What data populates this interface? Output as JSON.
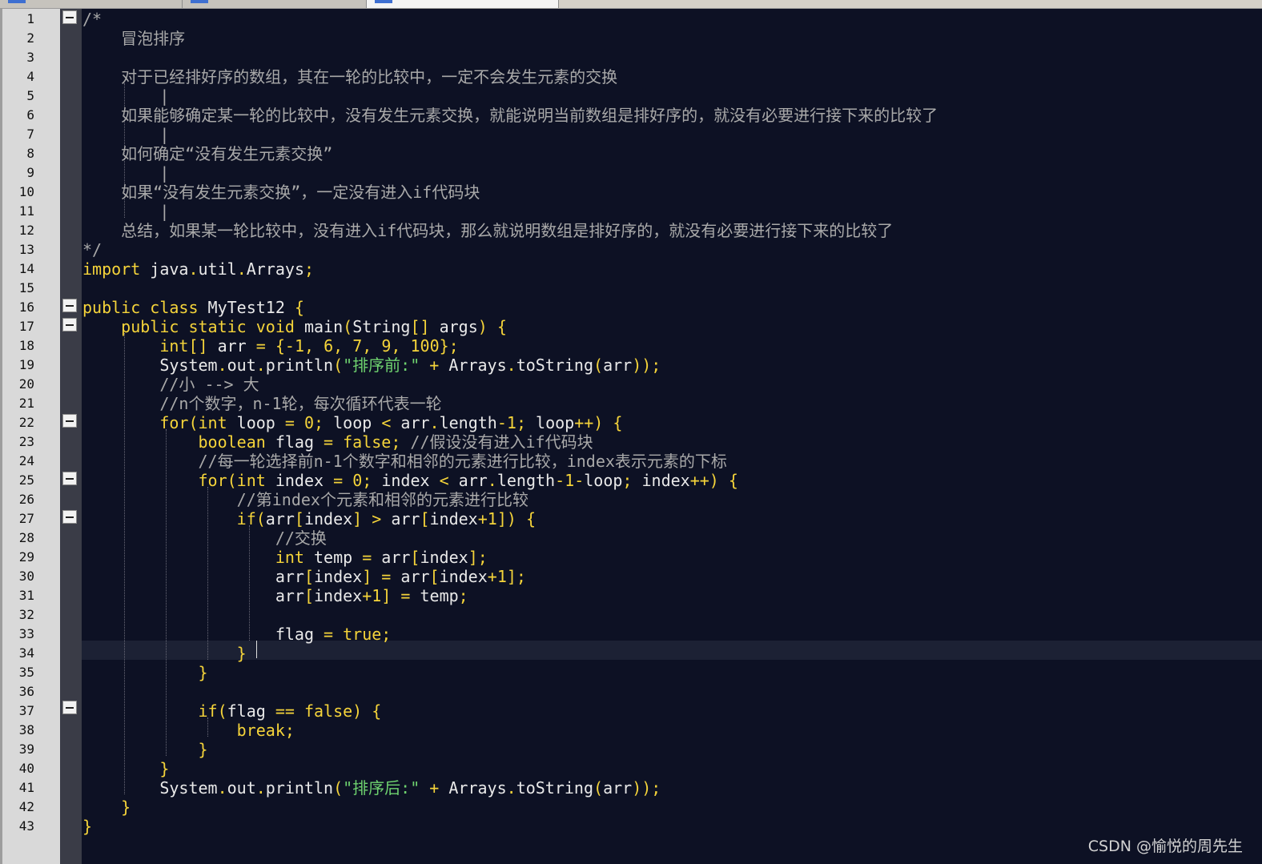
{
  "editor": {
    "colors": {
      "background": "#0d1124",
      "keyword": "#f5d43a",
      "string": "#6fd36f",
      "comment": "#a9a9a9"
    },
    "line_numbers": [
      "1",
      "2",
      "3",
      "4",
      "5",
      "6",
      "7",
      "8",
      "9",
      "10",
      "11",
      "12",
      "13",
      "14",
      "15",
      "16",
      "17",
      "18",
      "19",
      "20",
      "21",
      "22",
      "23",
      "24",
      "25",
      "26",
      "27",
      "28",
      "29",
      "30",
      "31",
      "32",
      "33",
      "34",
      "35",
      "36",
      "37",
      "38",
      "39",
      "40",
      "41",
      "42",
      "43"
    ],
    "lines": [
      [
        [
          "c",
          "/*"
        ]
      ],
      [
        [
          "c",
          "    冒泡排序"
        ]
      ],
      [],
      [
        [
          "c",
          "    对于已经排好序的数组，其在一轮的比较中，一定不会发生元素的交换"
        ]
      ],
      [
        [
          "c",
          "        |"
        ]
      ],
      [
        [
          "c",
          "    如果能够确定某一轮的比较中，没有发生元素交换，就能说明当前数组是排好序的，就没有必要进行接下来的比较了"
        ]
      ],
      [
        [
          "c",
          "        |"
        ]
      ],
      [
        [
          "c",
          "    如何确定“没有发生元素交换”"
        ]
      ],
      [
        [
          "c",
          "        |"
        ]
      ],
      [
        [
          "c",
          "    如果“没有发生元素交换”，一定没有进入if代码块"
        ]
      ],
      [
        [
          "c",
          "        |"
        ]
      ],
      [
        [
          "c",
          "    总结，如果某一轮比较中，没有进入if代码块，那么就说明数组是排好序的，就没有必要进行接下来的比较了"
        ]
      ],
      [
        [
          "c",
          "*/"
        ]
      ],
      [
        [
          "k",
          "import"
        ],
        [
          "i",
          " java"
        ],
        [
          "k",
          "."
        ],
        [
          "i",
          "util"
        ],
        [
          "k",
          "."
        ],
        [
          "i",
          "Arrays"
        ],
        [
          "k",
          ";"
        ]
      ],
      [],
      [
        [
          "k",
          "public class"
        ],
        [
          "i",
          " MyTest12 "
        ],
        [
          "k",
          "{"
        ]
      ],
      [
        [
          "i",
          "    "
        ],
        [
          "k",
          "public static void"
        ],
        [
          "i",
          " main"
        ],
        [
          "k",
          "("
        ],
        [
          "i",
          "String"
        ],
        [
          "k",
          "[]"
        ],
        [
          "i",
          " args"
        ],
        [
          "k",
          ") {"
        ]
      ],
      [
        [
          "i",
          "        "
        ],
        [
          "k",
          "int[]"
        ],
        [
          "i",
          " arr "
        ],
        [
          "k",
          "= {-"
        ],
        [
          "n",
          "1"
        ],
        [
          "k",
          ", "
        ],
        [
          "n",
          "6"
        ],
        [
          "k",
          ", "
        ],
        [
          "n",
          "7"
        ],
        [
          "k",
          ", "
        ],
        [
          "n",
          "9"
        ],
        [
          "k",
          ", "
        ],
        [
          "n",
          "100"
        ],
        [
          "k",
          "};"
        ]
      ],
      [
        [
          "i",
          "        System"
        ],
        [
          "k",
          "."
        ],
        [
          "i",
          "out"
        ],
        [
          "k",
          "."
        ],
        [
          "i",
          "println"
        ],
        [
          "k",
          "("
        ],
        [
          "s",
          "\"排序前:\""
        ],
        [
          "k",
          " + "
        ],
        [
          "i",
          "Arrays"
        ],
        [
          "k",
          "."
        ],
        [
          "i",
          "toString"
        ],
        [
          "k",
          "("
        ],
        [
          "i",
          "arr"
        ],
        [
          "k",
          "));"
        ]
      ],
      [
        [
          "c",
          "        //小 --> 大"
        ]
      ],
      [
        [
          "c",
          "        //n个数字，n-1轮，每次循环代表一轮"
        ]
      ],
      [
        [
          "i",
          "        "
        ],
        [
          "k",
          "for(int"
        ],
        [
          "i",
          " loop "
        ],
        [
          "k",
          "= "
        ],
        [
          "n",
          "0"
        ],
        [
          "k",
          "; "
        ],
        [
          "i",
          "loop "
        ],
        [
          "k",
          "< "
        ],
        [
          "i",
          "arr"
        ],
        [
          "k",
          "."
        ],
        [
          "i",
          "length"
        ],
        [
          "k",
          "-"
        ],
        [
          "n",
          "1"
        ],
        [
          "k",
          "; "
        ],
        [
          "i",
          "loop"
        ],
        [
          "k",
          "++) {"
        ]
      ],
      [
        [
          "i",
          "            "
        ],
        [
          "k",
          "boolean"
        ],
        [
          "i",
          " flag "
        ],
        [
          "k",
          "= false; "
        ],
        [
          "c",
          "//假设没有进入if代码块"
        ]
      ],
      [
        [
          "c",
          "            //每一轮选择前n-1个数字和相邻的元素进行比较，index表示元素的下标"
        ]
      ],
      [
        [
          "i",
          "            "
        ],
        [
          "k",
          "for(int"
        ],
        [
          "i",
          " index "
        ],
        [
          "k",
          "= "
        ],
        [
          "n",
          "0"
        ],
        [
          "k",
          "; "
        ],
        [
          "i",
          "index "
        ],
        [
          "k",
          "< "
        ],
        [
          "i",
          "arr"
        ],
        [
          "k",
          "."
        ],
        [
          "i",
          "length"
        ],
        [
          "k",
          "-"
        ],
        [
          "n",
          "1"
        ],
        [
          "k",
          "-"
        ],
        [
          "i",
          "loop"
        ],
        [
          "k",
          "; "
        ],
        [
          "i",
          "index"
        ],
        [
          "k",
          "++) {"
        ]
      ],
      [
        [
          "c",
          "                //第index个元素和相邻的元素进行比较"
        ]
      ],
      [
        [
          "i",
          "                "
        ],
        [
          "k",
          "if("
        ],
        [
          "i",
          "arr"
        ],
        [
          "k",
          "["
        ],
        [
          "i",
          "index"
        ],
        [
          "k",
          "] > "
        ],
        [
          "i",
          "arr"
        ],
        [
          "k",
          "["
        ],
        [
          "i",
          "index"
        ],
        [
          "k",
          "+"
        ],
        [
          "n",
          "1"
        ],
        [
          "k",
          "]) {"
        ]
      ],
      [
        [
          "c",
          "                    //交换"
        ]
      ],
      [
        [
          "i",
          "                    "
        ],
        [
          "k",
          "int"
        ],
        [
          "i",
          " temp "
        ],
        [
          "k",
          "= "
        ],
        [
          "i",
          "arr"
        ],
        [
          "k",
          "["
        ],
        [
          "i",
          "index"
        ],
        [
          "k",
          "];"
        ]
      ],
      [
        [
          "i",
          "                    arr"
        ],
        [
          "k",
          "["
        ],
        [
          "i",
          "index"
        ],
        [
          "k",
          "] = "
        ],
        [
          "i",
          "arr"
        ],
        [
          "k",
          "["
        ],
        [
          "i",
          "index"
        ],
        [
          "k",
          "+"
        ],
        [
          "n",
          "1"
        ],
        [
          "k",
          "];"
        ]
      ],
      [
        [
          "i",
          "                    arr"
        ],
        [
          "k",
          "["
        ],
        [
          "i",
          "index"
        ],
        [
          "k",
          "+"
        ],
        [
          "n",
          "1"
        ],
        [
          "k",
          "] = "
        ],
        [
          "i",
          "temp"
        ],
        [
          "k",
          ";"
        ]
      ],
      [],
      [
        [
          "i",
          "                    flag "
        ],
        [
          "k",
          "= true;"
        ]
      ],
      [
        [
          "i",
          "                "
        ],
        [
          "k",
          "}"
        ]
      ],
      [
        [
          "i",
          "            "
        ],
        [
          "k",
          "}"
        ]
      ],
      [],
      [
        [
          "i",
          "            "
        ],
        [
          "k",
          "if("
        ],
        [
          "i",
          "flag "
        ],
        [
          "k",
          "== false) {"
        ]
      ],
      [
        [
          "i",
          "                "
        ],
        [
          "k",
          "break;"
        ]
      ],
      [
        [
          "i",
          "            "
        ],
        [
          "k",
          "}"
        ]
      ],
      [
        [
          "i",
          "        "
        ],
        [
          "k",
          "}"
        ]
      ],
      [
        [
          "i",
          "        System"
        ],
        [
          "k",
          "."
        ],
        [
          "i",
          "out"
        ],
        [
          "k",
          "."
        ],
        [
          "i",
          "println"
        ],
        [
          "k",
          "("
        ],
        [
          "s",
          "\"排序后:\""
        ],
        [
          "k",
          " + "
        ],
        [
          "i",
          "Arrays"
        ],
        [
          "k",
          "."
        ],
        [
          "i",
          "toString"
        ],
        [
          "k",
          "("
        ],
        [
          "i",
          "arr"
        ],
        [
          "k",
          "));"
        ]
      ],
      [
        [
          "i",
          "    "
        ],
        [
          "k",
          "}"
        ]
      ],
      [
        [
          "k",
          "}"
        ]
      ]
    ]
  },
  "watermark": "CSDN @愉悦的周先生"
}
